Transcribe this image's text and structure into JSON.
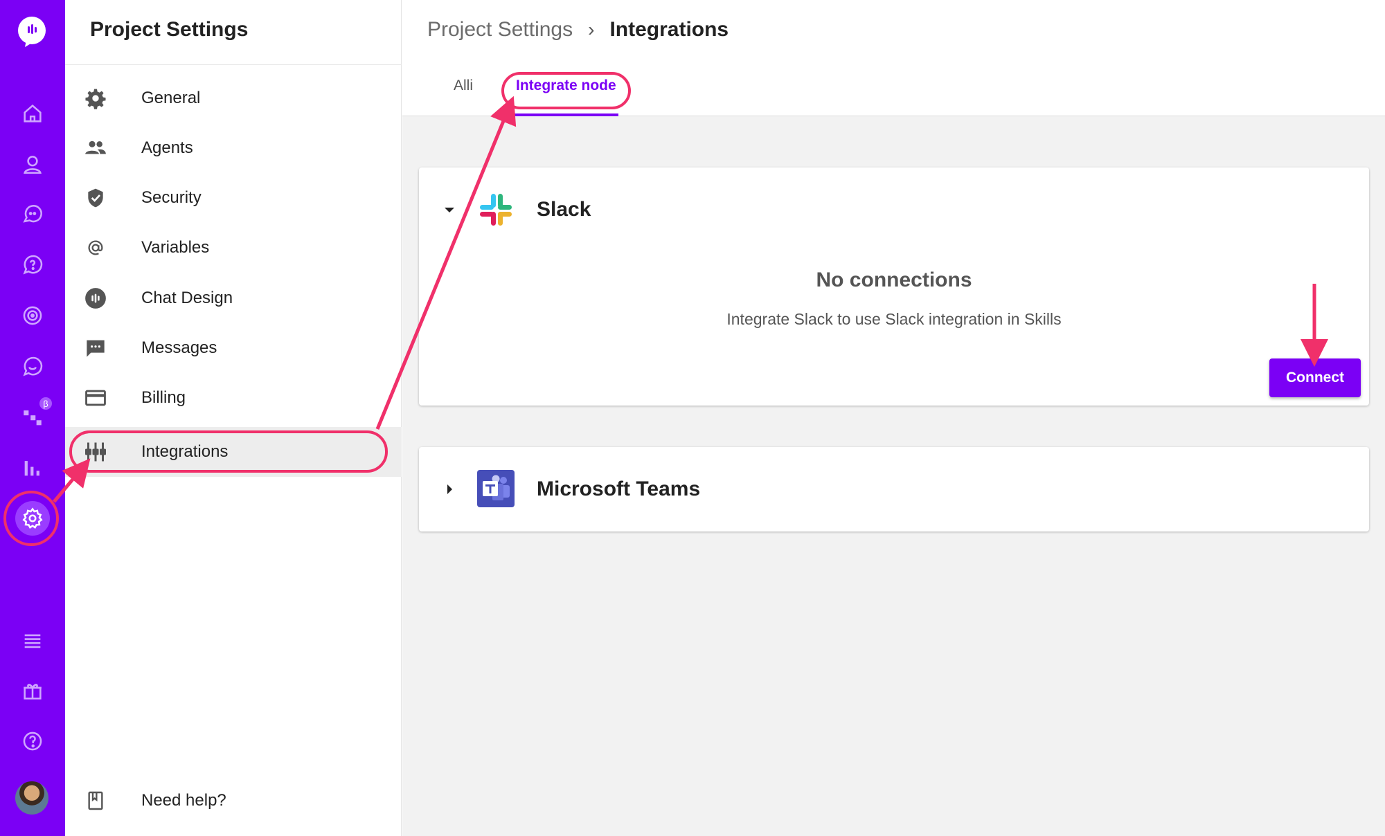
{
  "colors": {
    "brand": "#7b00f5",
    "annotation": "#f0306a",
    "active_bg": "#ededed"
  },
  "rail": {
    "icons": [
      "logo-icon",
      "home-icon",
      "user-icon",
      "chat-bubbles-icon",
      "help-bubble-icon",
      "target-icon",
      "smiley-chat-icon",
      "workflow-icon",
      "bar-chart-icon",
      "settings-gear-icon",
      "menu-lines-icon",
      "gift-icon",
      "question-icon"
    ],
    "beta_badge": "β"
  },
  "settings": {
    "title": "Project Settings",
    "items": [
      {
        "label": "General",
        "icon": "gear-icon"
      },
      {
        "label": "Agents",
        "icon": "people-icon"
      },
      {
        "label": "Security",
        "icon": "shield-icon"
      },
      {
        "label": "Variables",
        "icon": "at-sign-icon"
      },
      {
        "label": "Chat Design",
        "icon": "chat-design-icon"
      },
      {
        "label": "Messages",
        "icon": "message-dots-icon"
      },
      {
        "label": "Billing",
        "icon": "credit-card-icon"
      },
      {
        "label": "Integrations",
        "icon": "integrations-icon",
        "active": true
      }
    ],
    "help": {
      "label": "Need help?",
      "icon": "book-icon"
    }
  },
  "breadcrumb": {
    "parent": "Project Settings",
    "separator": "›",
    "current": "Integrations"
  },
  "tabs": [
    {
      "label": "Alli"
    },
    {
      "label": "Integrate node",
      "active": true
    }
  ],
  "integrations": [
    {
      "name": "Slack",
      "expanded": true,
      "empty_title": "No connections",
      "empty_text": "Integrate Slack to use Slack integration in Skills",
      "action_label": "Connect"
    },
    {
      "name": "Microsoft Teams",
      "expanded": false
    }
  ]
}
